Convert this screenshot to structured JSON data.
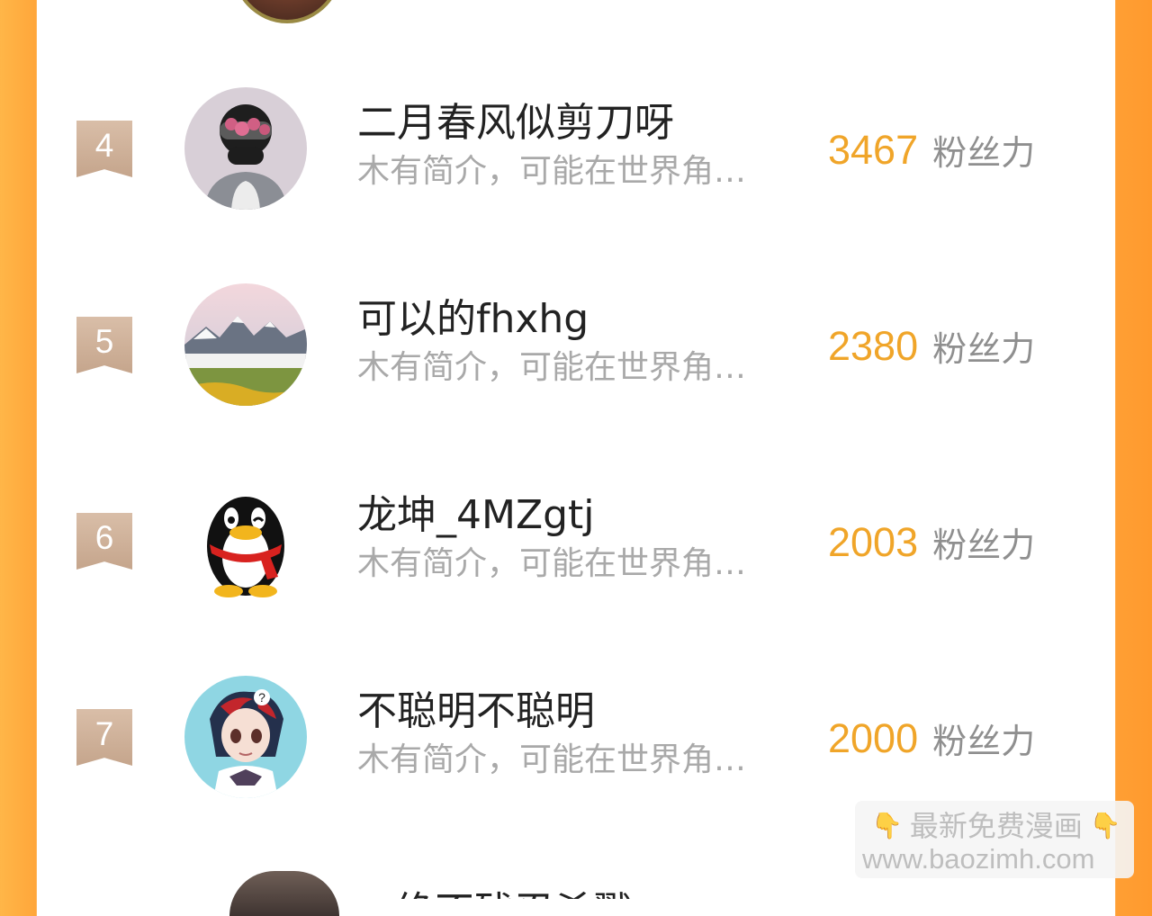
{
  "leaderboard": {
    "fans_unit": "粉丝力",
    "rows": [
      {
        "rank": "4",
        "name": "二月春风似剪刀呀",
        "bio": "木有简介，可能在世界角…",
        "fans": "3467"
      },
      {
        "rank": "5",
        "name": "可以的fhxhg",
        "bio": "木有简介，可能在世界角…",
        "fans": "2380"
      },
      {
        "rank": "6",
        "name": "龙坤_4MZgtj",
        "bio": "木有简介，可能在世界角…",
        "fans": "2003"
      },
      {
        "rank": "7",
        "name": "不聪明不聪明",
        "bio": "木有简介，可能在世界角…",
        "fans": "2000"
      }
    ]
  },
  "partial_next_row": {
    "name": "绝不残忍杀戮"
  },
  "watermark": {
    "emoji": "👇",
    "line1": "最新免费漫画",
    "line2": "www.baozimh.com"
  }
}
